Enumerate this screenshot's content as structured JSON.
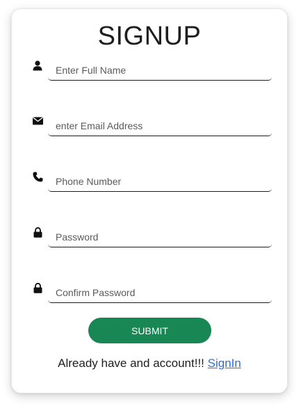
{
  "form": {
    "title": "SIGNUP",
    "fields": [
      {
        "placeholder": "Enter Full Name",
        "icon": "user-icon"
      },
      {
        "placeholder": "enter Email Address",
        "icon": "envelope-icon"
      },
      {
        "placeholder": "Phone Number",
        "icon": "phone-icon"
      },
      {
        "placeholder": "Password",
        "icon": "lock-icon"
      },
      {
        "placeholder": "Confirm Password",
        "icon": "lock-icon"
      }
    ],
    "submit_label": "SUBMIT",
    "footer_text": "Already have and account!!!",
    "signin_link": "SignIn"
  },
  "colors": {
    "submit_bg": "#198754",
    "link": "#2b6fd6"
  }
}
